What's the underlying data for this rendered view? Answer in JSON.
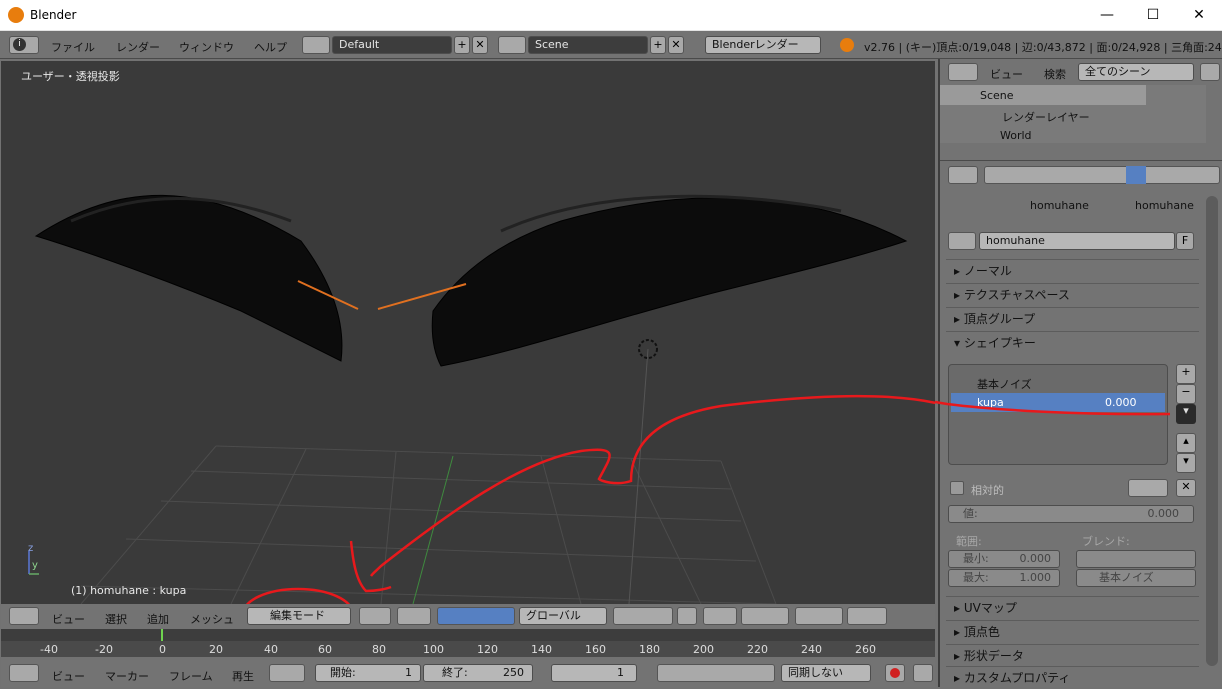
{
  "window": {
    "title": "Blender",
    "minimize": "—",
    "maximize": "☐",
    "close": "✕"
  },
  "info_header": {
    "menus": [
      "ファイル",
      "レンダー",
      "ウィンドウ",
      "ヘルプ"
    ],
    "layout": "Default",
    "scene": "Scene",
    "engine": "Blenderレンダー",
    "stats": "v2.76 | (キー)頂点:0/19,048 | 辺:0/43,872 | 面:0/24,928 | 三角面:24,9"
  },
  "viewport": {
    "label": "ユーザー・透視投影",
    "object_label": "(1) homuhane : kupa",
    "axis_z": "z",
    "axis_y": "y"
  },
  "view3d_header": {
    "menus": [
      "ビュー",
      "選択",
      "追加",
      "メッシュ"
    ],
    "mode": "編集モード",
    "orientation": "グローバル"
  },
  "timeline": {
    "ticks": [
      "-40",
      "-20",
      "0",
      "20",
      "40",
      "60",
      "80",
      "100",
      "120",
      "140",
      "160",
      "180",
      "200",
      "220",
      "240",
      "260"
    ],
    "menus": [
      "ビュー",
      "マーカー",
      "フレーム",
      "再生"
    ],
    "start_label": "開始:",
    "start": "1",
    "end_label": "終了:",
    "end": "250",
    "current": "1",
    "sync": "同期しない"
  },
  "outliner": {
    "menus": [
      "ビュー",
      "検索"
    ],
    "filter": "全てのシーン",
    "items": [
      "Scene",
      "レンダーレイヤー",
      "World"
    ]
  },
  "properties": {
    "breadcrumb": [
      "homuhane",
      "homuhane"
    ],
    "mesh_name": "homuhane",
    "fake_user": "F",
    "sections": [
      "ノーマル",
      "テクスチャスペース",
      "頂点グループ",
      "シェイプキー",
      "UVマップ",
      "頂点色",
      "形状データ",
      "カスタムプロパティ"
    ],
    "shape_keys": [
      {
        "name": "基本ノイズ",
        "value": ""
      },
      {
        "name": "kupa",
        "value": "0.000"
      }
    ],
    "relative_label": "相対的",
    "value_label": "値:",
    "value": "0.000",
    "range_label": "範囲:",
    "blend_label": "ブレンド:",
    "min_label": "最小:",
    "min": "0.000",
    "max_label": "最大:",
    "max": "1.000",
    "relative_key": "基本ノイズ"
  },
  "colors": {
    "selected": "#5680c2",
    "annotation": "#e8191c",
    "viewport": "#3a3a3a"
  }
}
